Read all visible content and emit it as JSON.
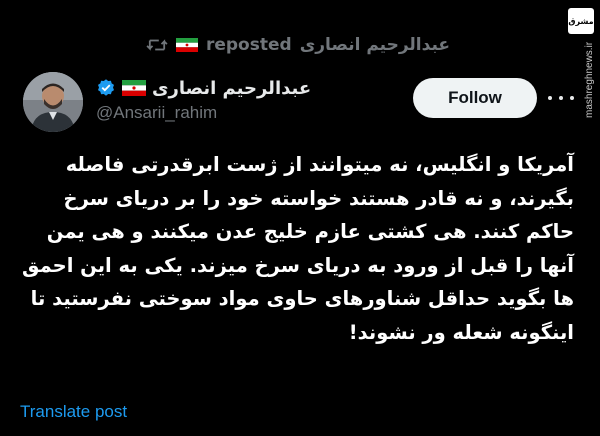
{
  "repost": {
    "label": "reposted",
    "user": "عبدالرحیم انصاری",
    "icon": "repost-icon"
  },
  "author": {
    "display_name": "عبدالرحیم انصاری",
    "handle": "@Ansarii_rahim",
    "verified": true,
    "flag_icon": "iran-flag-icon",
    "avatar_icon": "avatar"
  },
  "follow_button": {
    "label": "Follow"
  },
  "tweet": {
    "lines": [
      "آمریکا و انگلیس، نه میتوانند از ژست ابرقدرتی فاصله",
      "بگیرند، و نه قادر هستند خواسته خود را بر دریای سرخ",
      "حاکم کنند. هی کشتی عازم خلیج عدن میکنند و هی یمن",
      "آنها را قبل از ورود به دریای سرخ میزند. یکی به این احمق",
      "ها بگوید حداقل شناورهای حاوی مواد سوختی نفرستید تا",
      "اینگونه شعله ور نشوند!"
    ]
  },
  "translate_link": {
    "label": "Translate post"
  },
  "watermark": {
    "logo_text": "مشرق",
    "url": "mashreghnews.ir"
  },
  "colors": {
    "background": "#000000",
    "text": "#ffffff",
    "muted": "#71767b",
    "link": "#1d9bf0",
    "follow_bg": "#eff3f4",
    "verified": "#1d9bf0"
  }
}
